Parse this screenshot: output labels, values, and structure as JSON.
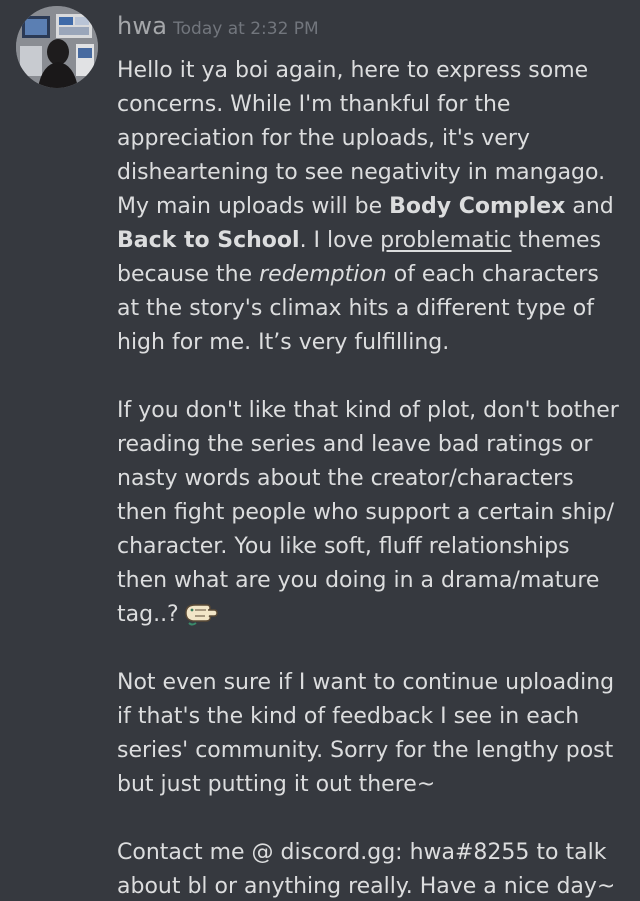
{
  "message": {
    "author": "hwa",
    "timestamp": "Today at 2:32 PM",
    "p1": {
      "t1": "Hello it ya boi again, here to express some concerns. While I'm thankful for the appreciation for the uploads, it's very disheartening to see negativity in mangago. My main uploads will be ",
      "bold1": "Body Complex",
      "t2": " and ",
      "bold2": "Back to School",
      "t3": ". I love ",
      "underline": "problematic",
      "t4": " themes because the ",
      "italic": "redemption",
      "t5": " of each characters at the story's climax hits a different type of high for me. It’s very fulfilling."
    },
    "p2": {
      "text": "If you don't like that kind of plot, don't bother reading the series and leave bad ratings or nasty words about the creator/characters then fight people who support a certain ship/ character. You like soft, fluff relationships then what are you doing in a drama/mature tag..?",
      "emoji": "pointing-hand-emoji"
    },
    "p3": "Not even sure if I want to continue uploading if that's the kind of feedback I see in each series' community. Sorry for the lengthy post but just putting it out there~",
    "p4": "Contact me @ discord.gg: hwa#8255 to talk about bl or anything really. Have a nice day~"
  },
  "colors": {
    "background": "#36393f",
    "text": "#dcddde",
    "username": "#a5a7aa",
    "timestamp": "#72767d"
  }
}
